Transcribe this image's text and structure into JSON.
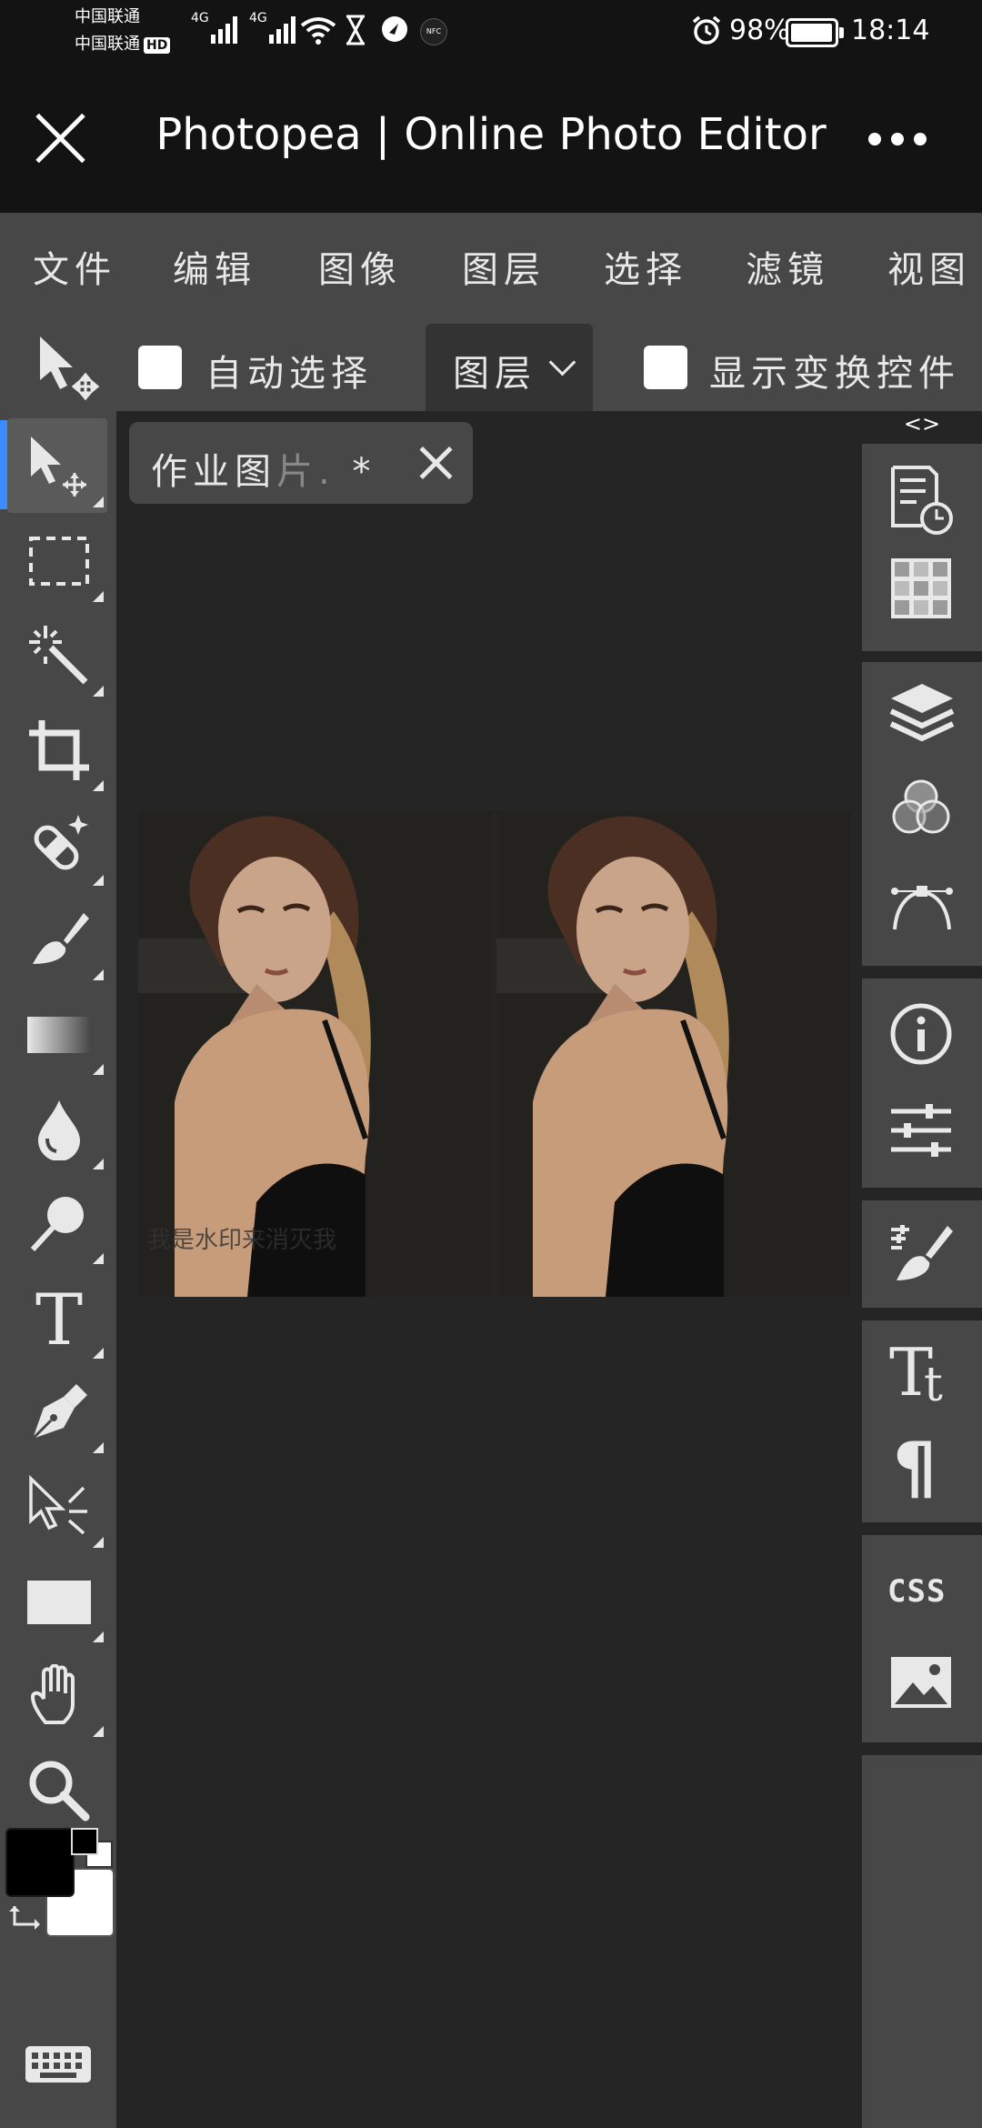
{
  "status_bar": {
    "carrier_1": "中国联通",
    "carrier_2": "中国联通",
    "hd_badge": "HD",
    "signal_label_1": "4G",
    "signal_label_2": "4G",
    "nfc_label": "NFC",
    "battery_percent": "98%",
    "time": "18:14"
  },
  "browser": {
    "title": "Photopea | Online Photo Editor"
  },
  "menu": {
    "items": [
      "文件",
      "编辑",
      "图像",
      "图层",
      "选择",
      "滤镜",
      "视图"
    ]
  },
  "options_bar": {
    "auto_select_label": "自动选择",
    "layer_dropdown_value": "图层",
    "show_transform_label": "显示变换控件"
  },
  "document": {
    "tab_name_main": "作业图",
    "tab_name_faded": "片.",
    "tab_modified": "*"
  },
  "right_panel": {
    "arrows": "<>",
    "css_label": "CSS"
  },
  "colors": {
    "accent": "#3d8cff",
    "panel": "#474747",
    "workspace": "#252525",
    "header": "#131313"
  }
}
